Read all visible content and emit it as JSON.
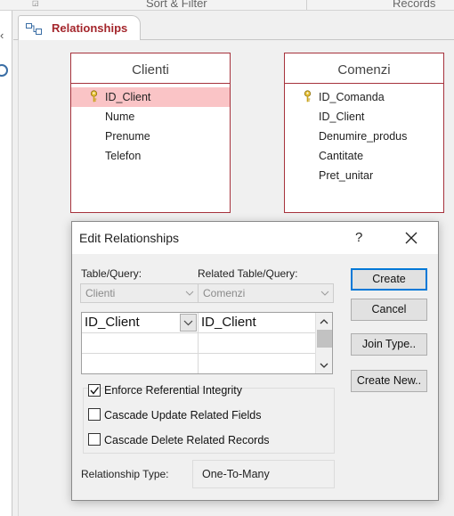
{
  "ribbon": {
    "groups": [
      "Sort & Filter",
      "Records"
    ]
  },
  "tab": {
    "label": "Relationships",
    "icon": "relationships-icon"
  },
  "tables": [
    {
      "name": "Clienti",
      "fields": [
        {
          "name": "ID_Client",
          "key": true,
          "selected": true
        },
        {
          "name": "Nume",
          "key": false
        },
        {
          "name": "Prenume",
          "key": false
        },
        {
          "name": "Telefon",
          "key": false
        }
      ]
    },
    {
      "name": "Comenzi",
      "fields": [
        {
          "name": "ID_Comanda",
          "key": true
        },
        {
          "name": "ID_Client",
          "key": false
        },
        {
          "name": "Denumire_produs",
          "key": false
        },
        {
          "name": "Cantitate",
          "key": false
        },
        {
          "name": "Pret_unitar",
          "key": false
        }
      ]
    }
  ],
  "dialog": {
    "title": "Edit Relationships",
    "help": "?",
    "table_query_label": "Table/Query:",
    "related_label": "Related Table/Query:",
    "table_query_value": "Clienti",
    "related_value": "Comenzi",
    "grid": {
      "rows": [
        [
          "ID_Client",
          "ID_Client"
        ],
        [
          "",
          ""
        ],
        [
          "",
          ""
        ]
      ]
    },
    "buttons": {
      "create": "Create",
      "cancel": "Cancel",
      "join_type": "Join Type..",
      "create_new": "Create New.."
    },
    "checkboxes": {
      "enforce": {
        "label": "Enforce Referential Integrity",
        "checked": true
      },
      "cascade_update": {
        "label": "Cascade Update Related Fields",
        "checked": false
      },
      "cascade_delete": {
        "label": "Cascade Delete Related Records",
        "checked": false
      }
    },
    "relationship_type_label": "Relationship Type:",
    "relationship_type_value": "One-To-Many"
  },
  "colors": {
    "table_border": "#a6323c",
    "selected_field": "#fac4c6",
    "tab_text": "#a4262c",
    "default_button_border": "#0078d7"
  }
}
